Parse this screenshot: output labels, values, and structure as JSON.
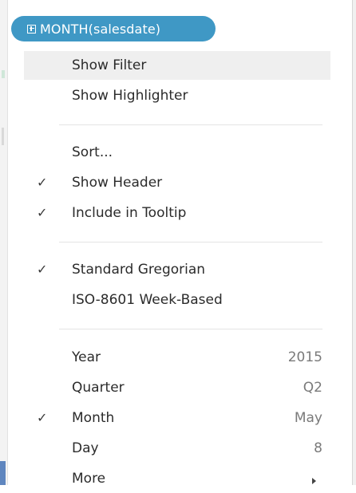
{
  "pill": {
    "label": "MONTH(salesdate)",
    "icon": "plus-box-icon",
    "color": "#3f98c5"
  },
  "menu": {
    "groups": [
      [
        {
          "name": "show-filter",
          "label": "Show Filter",
          "checked": false,
          "highlighted": true
        },
        {
          "name": "show-highlighter",
          "label": "Show Highlighter",
          "checked": false
        }
      ],
      [
        {
          "name": "sort",
          "label": "Sort...",
          "checked": false
        },
        {
          "name": "show-header",
          "label": "Show Header",
          "checked": true
        },
        {
          "name": "include-in-tooltip",
          "label": "Include in Tooltip",
          "checked": true
        }
      ],
      [
        {
          "name": "standard-gregorian",
          "label": "Standard Gregorian",
          "checked": true
        },
        {
          "name": "iso-8601-week-based",
          "label": "ISO-8601 Week-Based",
          "checked": false
        }
      ],
      [
        {
          "name": "year",
          "label": "Year",
          "value": "2015",
          "checked": false
        },
        {
          "name": "quarter",
          "label": "Quarter",
          "value": "Q2",
          "checked": false
        },
        {
          "name": "month",
          "label": "Month",
          "value": "May",
          "checked": true
        },
        {
          "name": "day",
          "label": "Day",
          "value": "8",
          "checked": false
        },
        {
          "name": "more",
          "label": "More",
          "submenu": true,
          "checked": false
        }
      ]
    ],
    "check_glyph": "✓",
    "highlight_color": "#efefef"
  }
}
